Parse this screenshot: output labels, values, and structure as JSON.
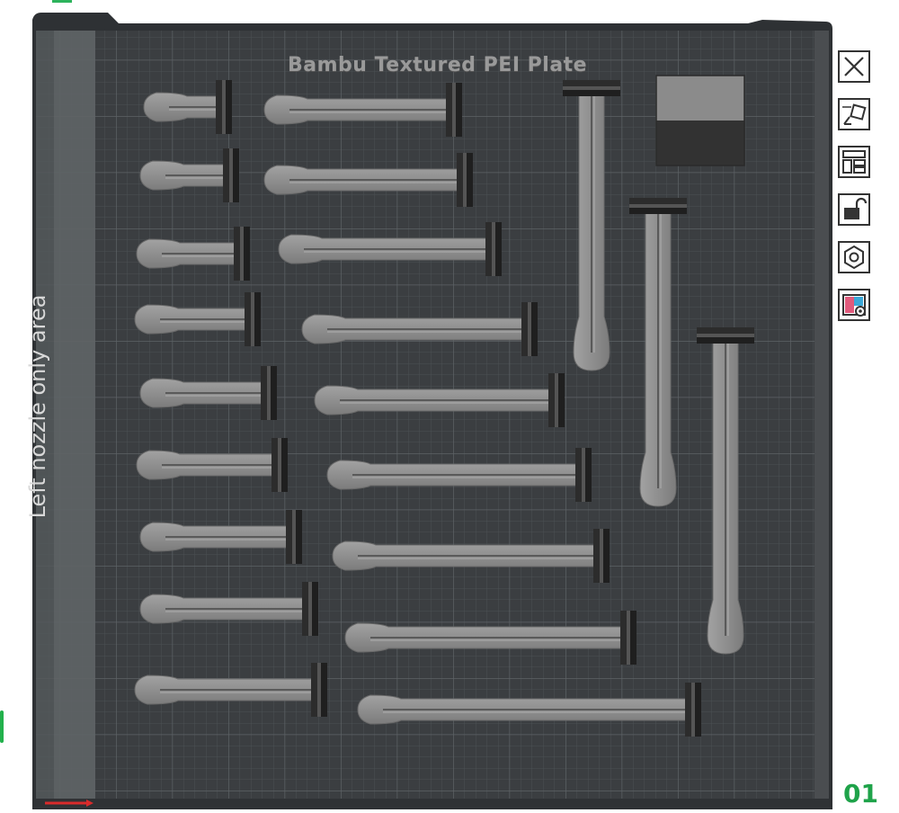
{
  "plate": {
    "title": "Bambu Textured PEI Plate",
    "left_nozzle_label": "Left nozzle only area",
    "number": "01"
  },
  "toolbar": [
    {
      "name": "close-icon"
    },
    {
      "name": "auto-orient-icon"
    },
    {
      "name": "arrange-icon"
    },
    {
      "name": "lock-icon"
    },
    {
      "name": "plate-settings-hex-icon"
    },
    {
      "name": "plate-preview-icon"
    }
  ],
  "colors": {
    "plate_base": "#3a3d40",
    "grid_line": "#4a4e52",
    "grid_major": "#5c6165",
    "model_grey": "#8f8f8f",
    "model_dark": "#2a2a2a",
    "accent_green": "#1fa34a"
  }
}
